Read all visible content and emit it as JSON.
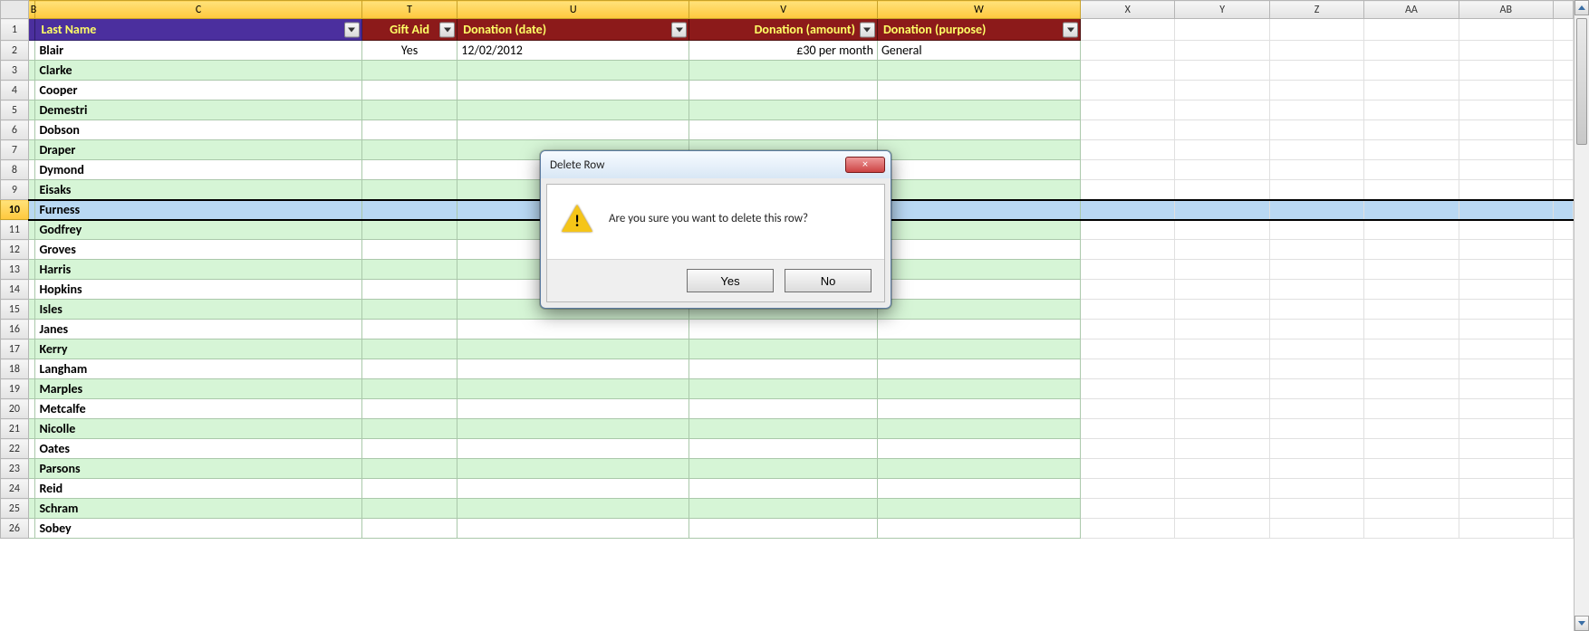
{
  "columns": {
    "select_all": "",
    "B": "B",
    "C": "C",
    "T": "T",
    "U": "U",
    "V": "V",
    "W": "W",
    "X": "X",
    "Y": "Y",
    "Z": "Z",
    "AA": "AA",
    "AB": "AB"
  },
  "headers": {
    "last_name": "Last Name",
    "gift_aid": "Gift Aid",
    "donation_date": "Donation (date)",
    "donation_amount": "Donation (amount)",
    "donation_purpose": "Donation (purpose)"
  },
  "rows": [
    {
      "n": 1,
      "type": "header"
    },
    {
      "n": 2,
      "last_name": "Blair",
      "gift_aid": "Yes",
      "donation_date": "12/02/2012",
      "donation_amount": "£30 per month",
      "donation_purpose": "General"
    },
    {
      "n": 3,
      "last_name": "Clarke"
    },
    {
      "n": 4,
      "last_name": "Cooper"
    },
    {
      "n": 5,
      "last_name": "Demestri"
    },
    {
      "n": 6,
      "last_name": "Dobson"
    },
    {
      "n": 7,
      "last_name": "Draper"
    },
    {
      "n": 8,
      "last_name": "Dymond"
    },
    {
      "n": 9,
      "last_name": "Eisaks"
    },
    {
      "n": 10,
      "last_name": "Furness",
      "selected": true
    },
    {
      "n": 11,
      "last_name": "Godfrey"
    },
    {
      "n": 12,
      "last_name": "Groves"
    },
    {
      "n": 13,
      "last_name": "Harris"
    },
    {
      "n": 14,
      "last_name": "Hopkins"
    },
    {
      "n": 15,
      "last_name": "Isles"
    },
    {
      "n": 16,
      "last_name": "Janes"
    },
    {
      "n": 17,
      "last_name": "Kerry"
    },
    {
      "n": 18,
      "last_name": "Langham"
    },
    {
      "n": 19,
      "last_name": "Marples"
    },
    {
      "n": 20,
      "last_name": "Metcalfe"
    },
    {
      "n": 21,
      "last_name": "Nicolle"
    },
    {
      "n": 22,
      "last_name": "Oates"
    },
    {
      "n": 23,
      "last_name": "Parsons"
    },
    {
      "n": 24,
      "last_name": "Reid"
    },
    {
      "n": 25,
      "last_name": "Schram"
    },
    {
      "n": 26,
      "last_name": "Sobey"
    }
  ],
  "dialog": {
    "title": "Delete Row",
    "message": "Are you sure you want to delete this row?",
    "yes": "Yes",
    "no": "No",
    "close": "×"
  }
}
